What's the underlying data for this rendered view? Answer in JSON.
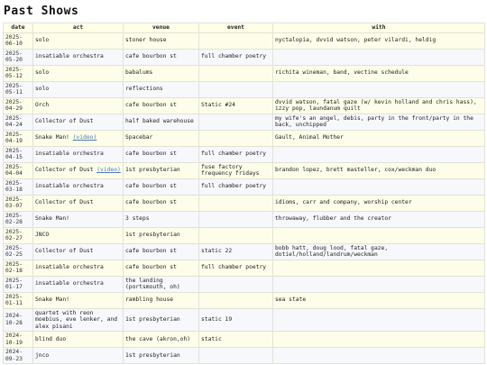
{
  "page": {
    "title": "Past Shows"
  },
  "table": {
    "headers": {
      "date": "date",
      "act": "act",
      "venue": "venue",
      "event": "event",
      "with": "with"
    },
    "video_label": "(video)",
    "rows": [
      {
        "date": "2025-06-10",
        "act": "solo",
        "venue": "stoner house",
        "event": "",
        "with": "nyctalopia, dvvid watson, peter vilardi, heldig"
      },
      {
        "date": "2025-05-20",
        "act": "insatiable orchestra",
        "venue": "cafe bourbon st",
        "event": "full chamber poetry",
        "with": ""
      },
      {
        "date": "2025-05-12",
        "act": "solo",
        "venue": "babalums",
        "event": "",
        "with": "richita wineman, band, vectine schedule"
      },
      {
        "date": "2025-05-11",
        "act": "solo",
        "venue": "reflections",
        "event": "",
        "with": ""
      },
      {
        "date": "2025-04-29",
        "act": "Orch",
        "venue": "cafe bourbon st",
        "event": "Static #24",
        "with": "dvvid watson, fatal gaze (w/ kevin holland and chris hass), izzy pop, laundanum quilt"
      },
      {
        "date": "2025-04-24",
        "act": "Collector of Dust",
        "venue": "half baked warehouse",
        "event": "",
        "with": "my wife's an angel, debis, party in the front/party in the back, unchipped"
      },
      {
        "date": "2025-04-19",
        "act": "Snake Man!",
        "video": true,
        "venue": "Spacebar",
        "event": "",
        "with": "Gault, Animal Mother"
      },
      {
        "date": "2025-04-15",
        "act": "insatiable orchestra",
        "venue": "cafe bourbon st",
        "event": "full chamber poetry",
        "with": ""
      },
      {
        "date": "2025-04-04",
        "act": "Collector of Dust",
        "video": true,
        "venue": "1st presbyterian",
        "event": "fuse factory frequency fridays",
        "with": "brandon lopez, brett masteller, cox/weckman duo"
      },
      {
        "date": "2025-03-18",
        "act": "insatiable orchestra",
        "venue": "cafe bourbon st",
        "event": "full chamber poetry",
        "with": ""
      },
      {
        "date": "2025-03-07",
        "act": "Collector of Dust",
        "venue": "cafe bourbon st",
        "event": "",
        "with": "idioms, carr and company, worship center"
      },
      {
        "date": "2025-02-28",
        "act": "Snake Man!",
        "venue": "3 steps",
        "event": "",
        "with": "throwaway, flubber and the creator"
      },
      {
        "date": "2025-02-27",
        "act": "JNCO",
        "venue": "1st presbyterian",
        "event": "",
        "with": ""
      },
      {
        "date": "2025-02-25",
        "act": "Collector of Dust",
        "venue": "cafe bourbon st",
        "event": "static 22",
        "with": "bobb hatt, doug lood, fatal gaze, dotiel/holland/landrum/weckman"
      },
      {
        "date": "2025-02-18",
        "act": "insatiable orchestra",
        "venue": "cafe bourbon st",
        "event": "full chamber poetry",
        "with": ""
      },
      {
        "date": "2025-01-17",
        "act": "insatiable orchestra",
        "venue": "the landing (portsmouth, oh)",
        "event": "",
        "with": ""
      },
      {
        "date": "2025-01-11",
        "act": "Snake Man!",
        "venue": "rambling house",
        "event": "",
        "with": "sea state"
      },
      {
        "date": "2024-10-28",
        "act": "quartet with reon moebius, eve lenker, and alex pisani",
        "venue": "1st presbyterian",
        "event": "static 19",
        "with": ""
      },
      {
        "date": "2024-10-19",
        "act": "blind duo",
        "venue": "the cave (akron,oh)",
        "event": "static",
        "with": ""
      },
      {
        "date": "2024-09-23",
        "act": "jnco",
        "venue": "1st presbyterian",
        "event": "",
        "with": ""
      }
    ]
  }
}
